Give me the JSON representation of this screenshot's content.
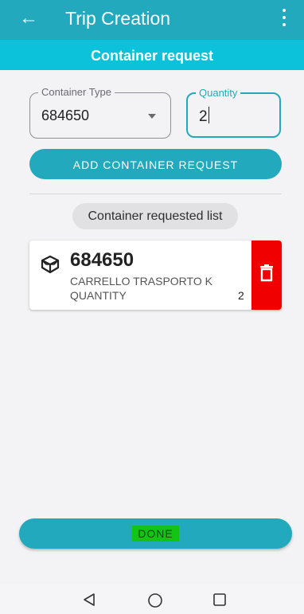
{
  "appbar": {
    "title": "Trip Creation",
    "back_icon": "arrow-left-icon",
    "menu_icon": "more-vert-icon"
  },
  "subheader": {
    "title": "Container request"
  },
  "form": {
    "container_type": {
      "label": "Container Type",
      "value": "684650"
    },
    "quantity": {
      "label": "Quantity",
      "value": "2"
    },
    "add_button": "ADD CONTAINER REQUEST"
  },
  "list": {
    "header": "Container requested list",
    "items": [
      {
        "code": "684650",
        "description": "CARRELLO TRASPORTO K",
        "quantity_label": "QUANTITY",
        "quantity": "2",
        "icon": "package-icon",
        "delete_icon": "trash-icon"
      }
    ]
  },
  "done_button": "DONE",
  "colors": {
    "primary": "#22a9bd",
    "subheader": "#0cc2db",
    "delete": "#f00000",
    "highlight": "#14c414"
  }
}
